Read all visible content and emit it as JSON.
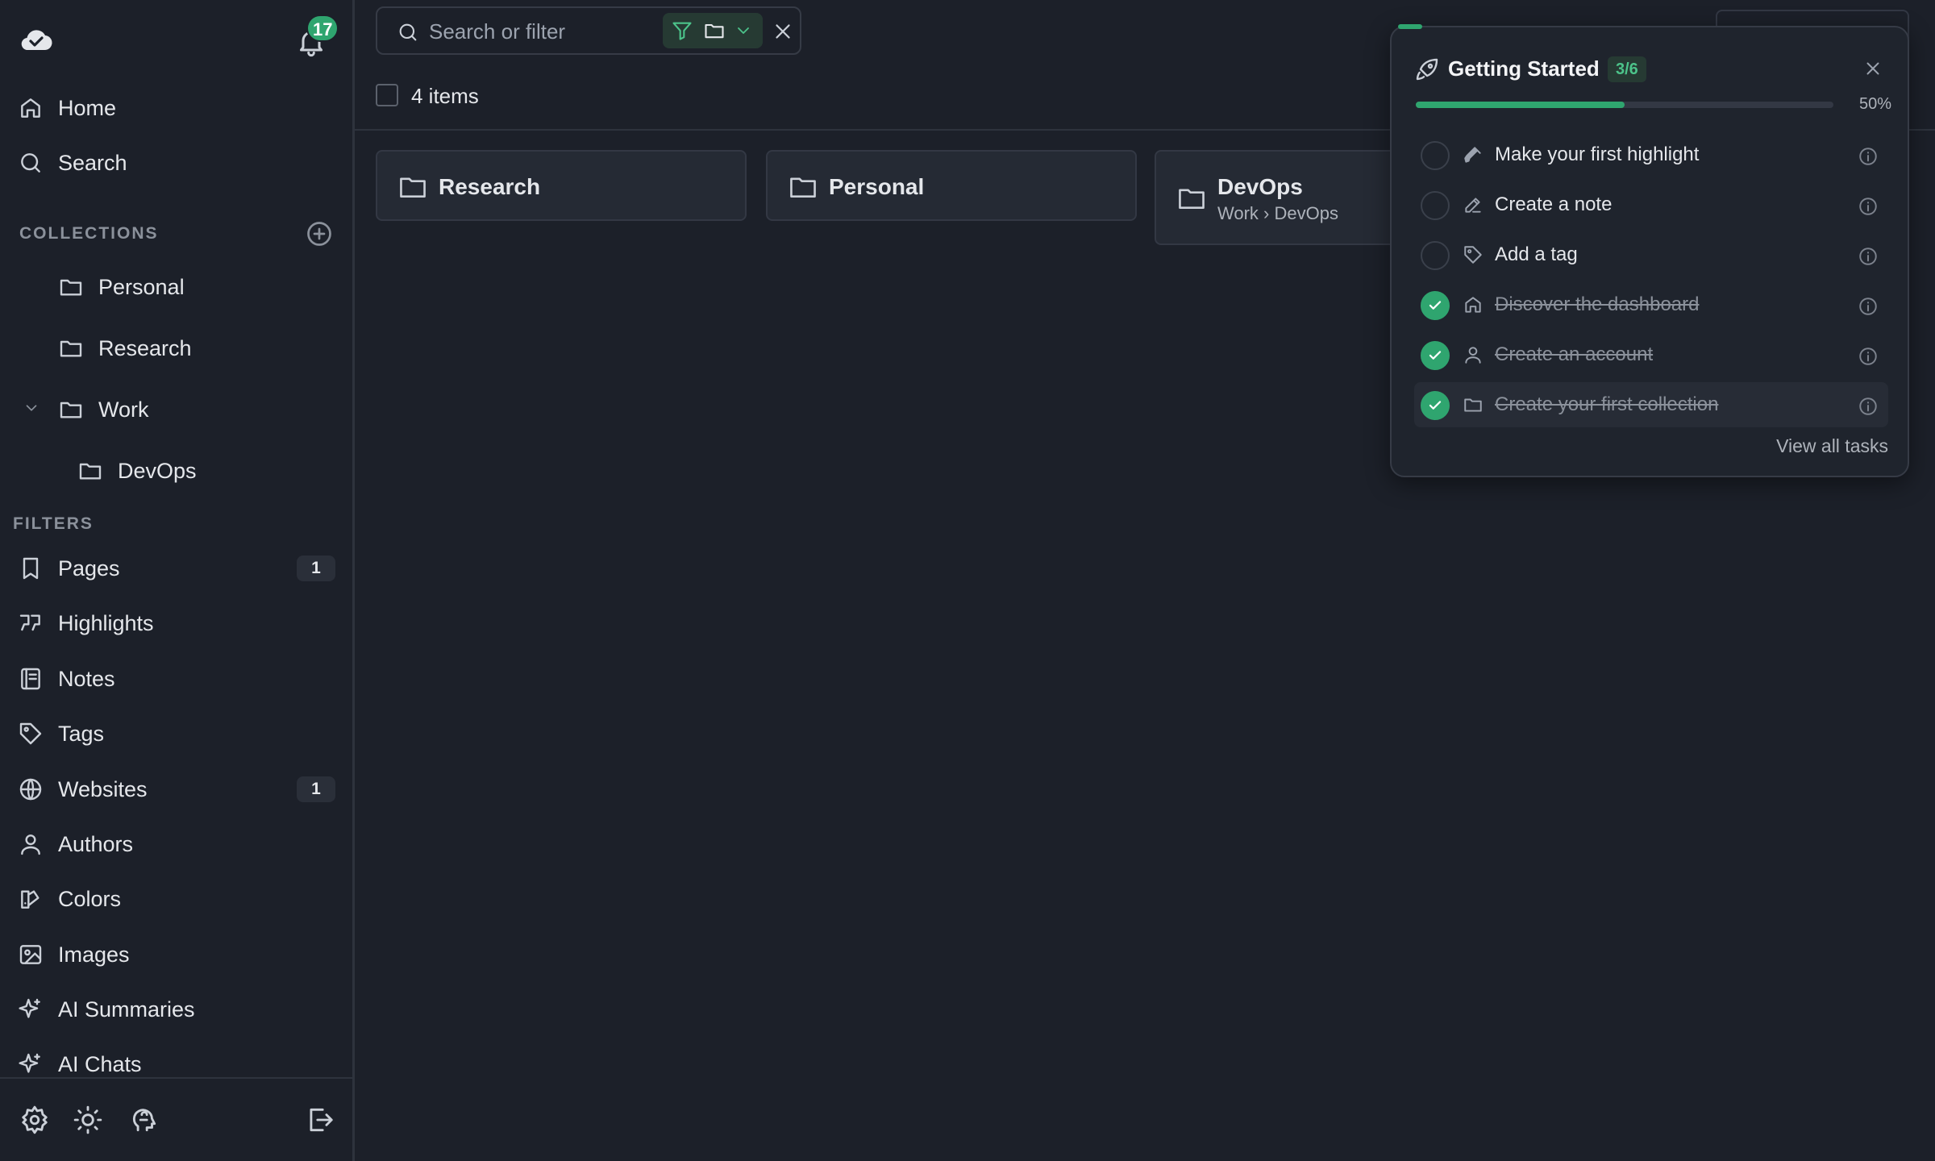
{
  "notifications": {
    "count": "17"
  },
  "nav": {
    "home": "Home",
    "search": "Search"
  },
  "collections": {
    "heading": "COLLECTIONS",
    "items": [
      "Personal",
      "Research",
      "Work",
      "DevOps"
    ]
  },
  "filters": {
    "heading": "FILTERS",
    "items": [
      {
        "label": "Pages",
        "icon": "bookmark-icon",
        "count": "1"
      },
      {
        "label": "Highlights",
        "icon": "quote-icon",
        "count": ""
      },
      {
        "label": "Notes",
        "icon": "notebook-icon",
        "count": ""
      },
      {
        "label": "Tags",
        "icon": "tag-icon",
        "count": ""
      },
      {
        "label": "Websites",
        "icon": "globe-icon",
        "count": "1"
      },
      {
        "label": "Authors",
        "icon": "user-icon",
        "count": ""
      },
      {
        "label": "Colors",
        "icon": "palette-icon",
        "count": ""
      },
      {
        "label": "Images",
        "icon": "image-icon",
        "count": ""
      },
      {
        "label": "AI Summaries",
        "icon": "sparkles-icon",
        "count": ""
      },
      {
        "label": "AI Chats",
        "icon": "sparkles-icon",
        "count": ""
      }
    ]
  },
  "search": {
    "placeholder": "Search or filter"
  },
  "list": {
    "items_count": "4 items"
  },
  "cards": [
    {
      "title": "Research",
      "subtitle": ""
    },
    {
      "title": "Personal",
      "subtitle": ""
    },
    {
      "title": "DevOps",
      "subtitle": "Work › DevOps"
    }
  ],
  "getting_started": {
    "title": "Getting Started",
    "fraction": "3/6",
    "percent_label": "50%",
    "progress": 0.5,
    "tasks": [
      {
        "label": "Make your first highlight",
        "done": false,
        "icon": "highlighter-icon"
      },
      {
        "label": "Create a note",
        "done": false,
        "icon": "pencil-icon"
      },
      {
        "label": "Add a tag",
        "done": false,
        "icon": "tag-icon"
      },
      {
        "label": "Discover the dashboard",
        "done": true,
        "icon": "home-icon"
      },
      {
        "label": "Create an account",
        "done": true,
        "icon": "user-icon"
      },
      {
        "label": "Create your first collection",
        "done": true,
        "icon": "folder-icon"
      }
    ],
    "view_all": "View all tasks"
  },
  "colors": {
    "accent": "#2fa56f",
    "background": "#1c2029",
    "card": "#252a34"
  }
}
